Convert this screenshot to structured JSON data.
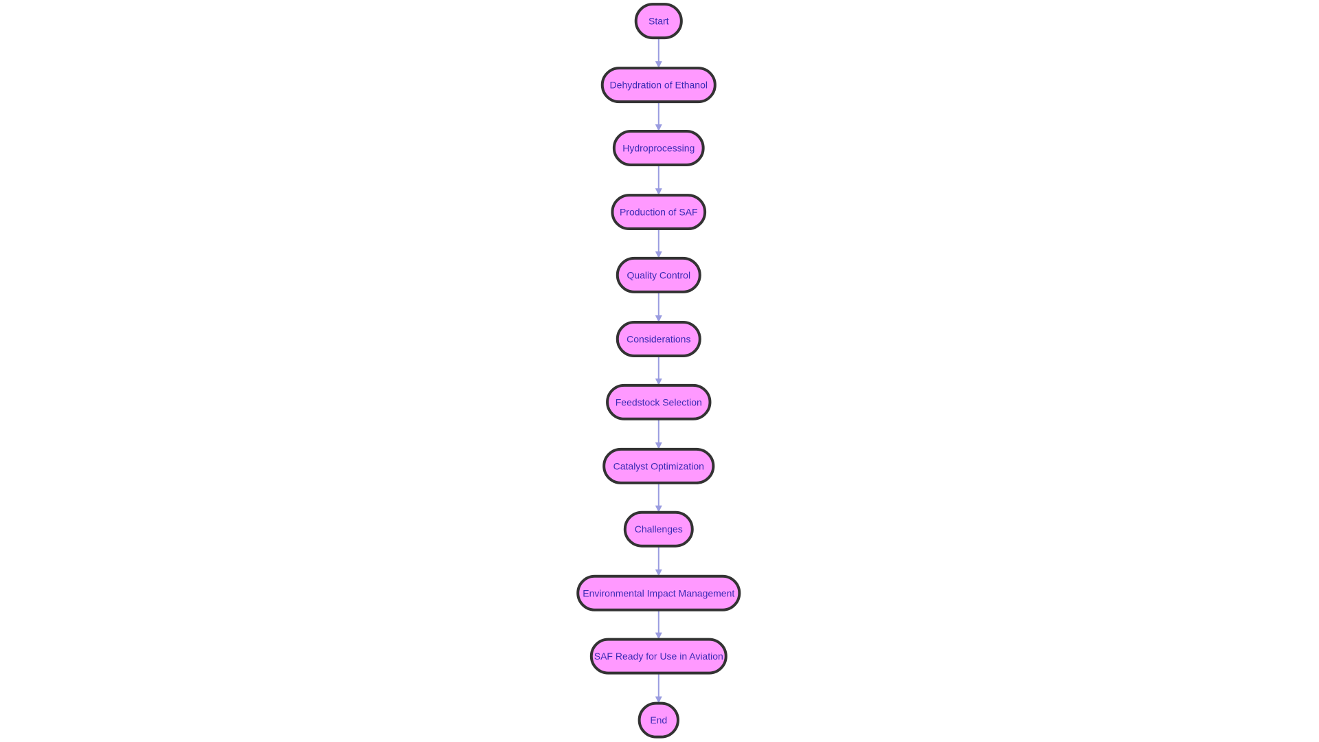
{
  "diagram": {
    "type": "flowchart",
    "direction": "top-to-bottom",
    "colors": {
      "node_fill": "#ff99ff",
      "node_border": "#333333",
      "node_text": "#3b2bb5",
      "edge": "#9a9ce0",
      "background": "#ffffff"
    },
    "nodes": [
      {
        "id": "start",
        "label": "Start",
        "shape": "stadium"
      },
      {
        "id": "dehydration",
        "label": "Dehydration of Ethanol",
        "shape": "stadium"
      },
      {
        "id": "hydroprocessing",
        "label": "Hydroprocessing",
        "shape": "stadium"
      },
      {
        "id": "production",
        "label": "Production of SAF",
        "shape": "stadium"
      },
      {
        "id": "quality",
        "label": "Quality Control",
        "shape": "stadium"
      },
      {
        "id": "considerations",
        "label": "Considerations",
        "shape": "stadium"
      },
      {
        "id": "feedstock",
        "label": "Feedstock Selection",
        "shape": "stadium"
      },
      {
        "id": "catalyst",
        "label": "Catalyst Optimization",
        "shape": "stadium"
      },
      {
        "id": "challenges",
        "label": "Challenges",
        "shape": "stadium"
      },
      {
        "id": "environmental",
        "label": "Environmental Impact Management",
        "shape": "stadium"
      },
      {
        "id": "saf_ready",
        "label": "SAF Ready for Use in Aviation",
        "shape": "stadium"
      },
      {
        "id": "end",
        "label": "End",
        "shape": "stadium"
      }
    ],
    "edges": [
      {
        "from": "start",
        "to": "dehydration"
      },
      {
        "from": "dehydration",
        "to": "hydroprocessing"
      },
      {
        "from": "hydroprocessing",
        "to": "production"
      },
      {
        "from": "production",
        "to": "quality"
      },
      {
        "from": "quality",
        "to": "considerations"
      },
      {
        "from": "considerations",
        "to": "feedstock"
      },
      {
        "from": "feedstock",
        "to": "catalyst"
      },
      {
        "from": "catalyst",
        "to": "challenges"
      },
      {
        "from": "challenges",
        "to": "environmental"
      },
      {
        "from": "environmental",
        "to": "saf_ready"
      },
      {
        "from": "saf_ready",
        "to": "end"
      }
    ]
  }
}
